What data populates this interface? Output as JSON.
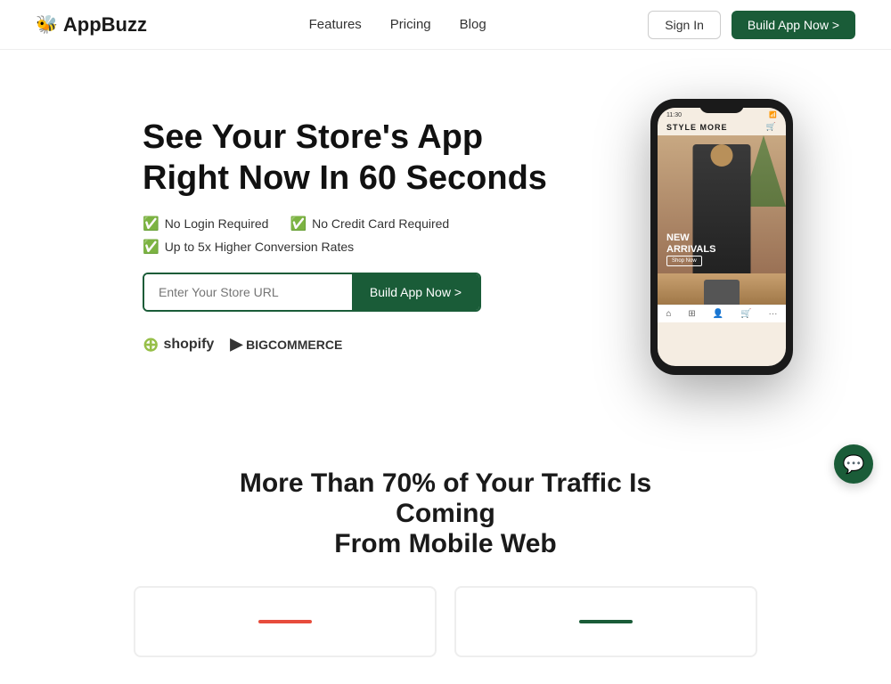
{
  "nav": {
    "logo_text": "AppBuzz",
    "logo_icon": "🐝",
    "links": [
      {
        "label": "Features",
        "id": "features"
      },
      {
        "label": "Pricing",
        "id": "pricing"
      },
      {
        "label": "Blog",
        "id": "blog"
      }
    ],
    "signin_label": "Sign In",
    "build_label": "Build App Now >"
  },
  "hero": {
    "title_line1": "See Your Store's App",
    "title_line2": "Right Now In 60 Seconds",
    "badges": [
      {
        "text": "No Login Required",
        "id": "no-login"
      },
      {
        "text": "No Credit Card Required",
        "id": "no-credit"
      },
      {
        "text": "Up to 5x Higher Conversion Rates",
        "id": "conversion"
      }
    ],
    "input_placeholder": "Enter Your Store URL",
    "build_button_label": "Build App Now >",
    "shopify_label": "shopify",
    "bigcommerce_label": "BIGCOMMERCE"
  },
  "phone": {
    "time": "11:30",
    "store_name": "STYLE MORE",
    "hero_text_line1": "NEW",
    "hero_text_line2": "ARRIVALS",
    "shop_now": "Shop Now"
  },
  "section2": {
    "heading_line1": "More Than 70% of Your Traffic Is Coming",
    "heading_line2": "From Mobile Web"
  }
}
